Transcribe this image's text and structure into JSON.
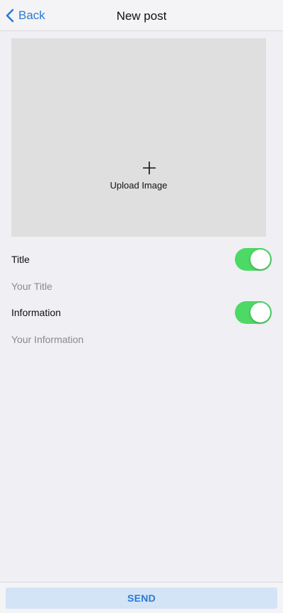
{
  "navbar": {
    "back_label": "Back",
    "back_icon": "chevron-left-icon",
    "title": "New post"
  },
  "upload": {
    "icon": "plus-icon",
    "label": "Upload Image"
  },
  "fields": [
    {
      "label": "Title",
      "placeholder": "Your Title",
      "toggle_on": true
    },
    {
      "label": "Information",
      "placeholder": "Your Information",
      "toggle_on": true
    }
  ],
  "footer": {
    "send_label": "SEND"
  },
  "colors": {
    "accent": "#2a7ad3",
    "toggle_on": "#4cd964",
    "background": "#efeff4",
    "upload_bg": "#dfdfdf",
    "send_bg": "#d3e4f7"
  }
}
